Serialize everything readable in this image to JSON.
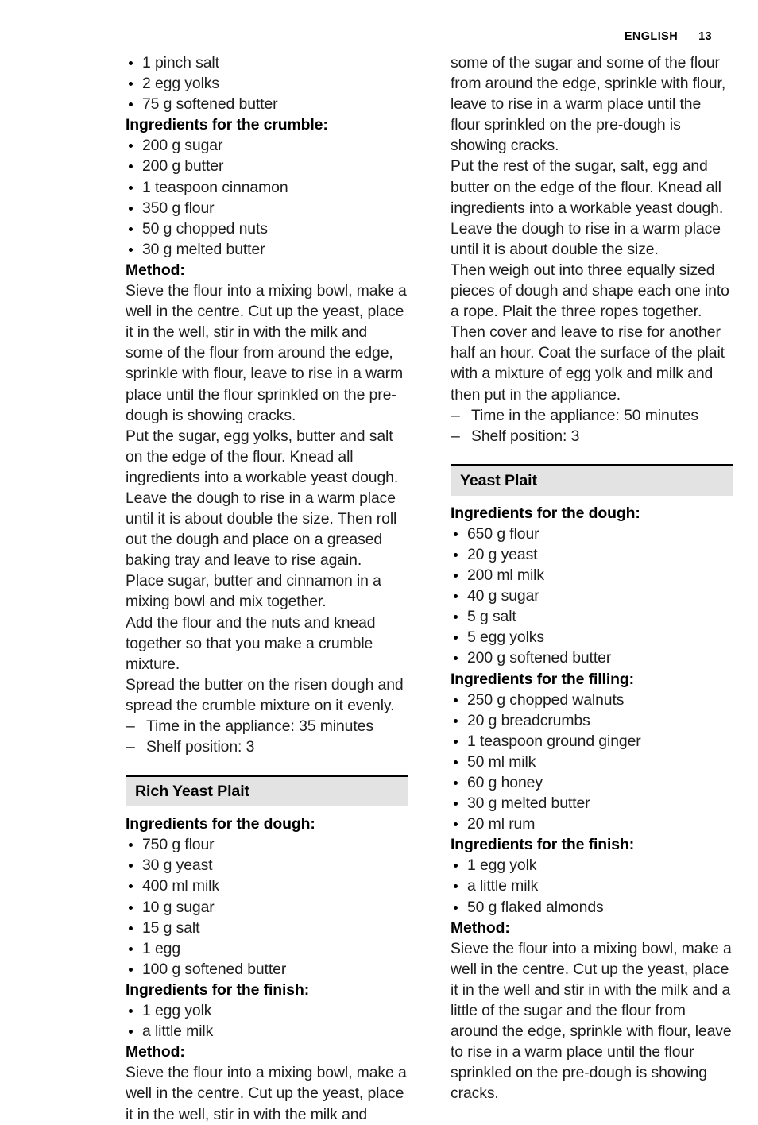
{
  "header": {
    "language": "ENGLISH",
    "page_number": "13"
  },
  "left_column": {
    "crumble_cake": {
      "dough_remainder_items": [
        "1 pinch salt",
        "2 egg yolks",
        "75 g softened butter"
      ],
      "crumble_heading": "Ingredients for the crumble:",
      "crumble_items": [
        "200 g sugar",
        "200 g butter",
        "1 teaspoon cinnamon",
        "350 g flour",
        "50 g chopped nuts",
        "30 g melted butter"
      ],
      "method_heading": "Method:",
      "method_paragraphs": [
        "Sieve the flour into a mixing bowl, make a well in the centre. Cut up the yeast, place it in the well, stir in with the milk and some of the flour from around the edge, sprinkle with flour, leave to rise in a warm place until the flour sprinkled on the pre-dough is showing cracks.",
        "Put the sugar, egg yolks, butter and salt on the edge of the flour. Knead all ingredients into a workable yeast dough.",
        "Leave the dough to rise in a warm place until it is about double the size. Then roll out the dough and place on a greased baking tray and leave to rise again.",
        "Place sugar, butter and cinnamon in a mixing bowl and mix together.",
        "Add the flour and the nuts and knead together so that you make a crumble mixture.",
        "Spread the butter on the risen dough and spread the crumble mixture on it evenly."
      ],
      "settings": [
        "Time in the appliance: 35 minutes",
        "Shelf position: 3"
      ]
    },
    "rich_yeast_plait": {
      "title": "Rich Yeast Plait",
      "dough_heading": "Ingredients for the dough:",
      "dough_items": [
        "750 g flour",
        "30 g yeast",
        "400 ml milk",
        "10 g sugar",
        "15 g salt",
        "1 egg",
        "100 g softened butter"
      ],
      "finish_heading": "Ingredients for the finish:",
      "finish_items": [
        "1 egg yolk",
        "a little milk"
      ],
      "method_heading": "Method:",
      "method_paragraphs": [
        "Sieve the flour into a mixing bowl, make a well in the centre. Cut up the yeast, place it in the well, stir in with the milk and"
      ]
    }
  },
  "right_column": {
    "rich_yeast_plait_continued": {
      "method_paragraphs": [
        "some of the sugar and some of the flour from around the edge, sprinkle with flour, leave to rise in a warm place until the flour sprinkled on the pre-dough is showing cracks.",
        "Put the rest of the sugar, salt, egg and butter on the edge of the flour. Knead all ingredients into a workable yeast dough.",
        "Leave the dough to rise in a warm place until it is about double the size.",
        "Then weigh out into three equally sized pieces of dough and shape each one into a rope. Plait the three ropes together. Then cover and leave to rise for another half an hour. Coat the surface of the plait with a mixture of egg yolk and milk and then put in the appliance."
      ],
      "settings": [
        "Time in the appliance: 50 minutes",
        "Shelf position: 3"
      ]
    },
    "yeast_plait": {
      "title": "Yeast Plait",
      "dough_heading": "Ingredients for the dough:",
      "dough_items": [
        "650 g flour",
        "20 g yeast",
        "200 ml milk",
        "40 g sugar",
        "5 g salt",
        "5 egg yolks",
        "200 g softened butter"
      ],
      "filling_heading": "Ingredients for the filling:",
      "filling_items": [
        "250 g chopped walnuts",
        "20 g breadcrumbs",
        "1 teaspoon ground ginger",
        "50 ml milk",
        "60 g honey",
        "30 g melted butter",
        "20 ml rum"
      ],
      "finish_heading": "Ingredients for the finish:",
      "finish_items": [
        "1 egg yolk",
        "a little milk",
        "50 g flaked almonds"
      ],
      "method_heading": "Method:",
      "method_paragraphs": [
        "Sieve the flour into a mixing bowl, make a well in the centre. Cut up the yeast, place it in the well and stir in with the milk and a little of the sugar and the flour from around the edge, sprinkle with flour, leave to rise in a warm place until the flour sprinkled on the pre-dough is showing cracks."
      ]
    }
  },
  "colors": {
    "section_header_bg": "#e3e3e3",
    "section_header_rule": "#000000",
    "text": "#1e1e1e"
  }
}
